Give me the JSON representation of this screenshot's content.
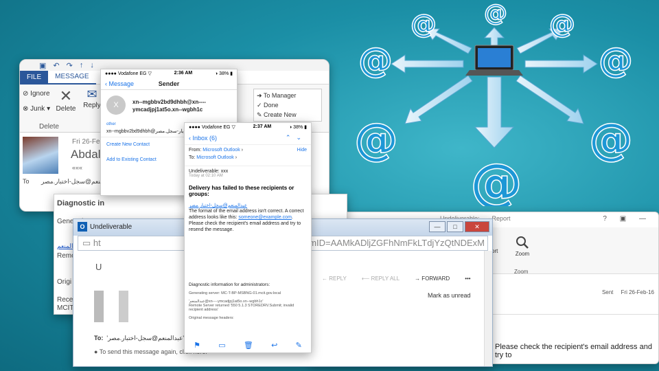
{
  "outlook": {
    "tab_file": "FILE",
    "tab_message": "MESSAGE",
    "ignore": "Ignore",
    "junk": "Junk",
    "delete_btn": "Delete",
    "reply": "Reply",
    "group_delete": "Delete",
    "to_manager": "To Manager",
    "done": "Done",
    "create_new": "Create New",
    "date": "Fri 26-Feb-",
    "name": "Abdalu",
    "extra": "«««",
    "to_label": "To",
    "to_value": "'عبدالمنعم@سجل-اختبار.مصر"
  },
  "phone_sender": {
    "carrier": "●●●● Vodafone EG ▽",
    "time": "2:36 AM",
    "battery": "◑ 38% ▮",
    "back": "Message",
    "title": "Sender",
    "avatar_letter": "X",
    "address_line1": "xn--mgbbv2bd9dhbh@xn----",
    "address_line2": "ymcadjpj1at5o.xn--wgbh1c",
    "other_label": "other",
    "other_value": "xn--mgbbv2bd9dhbh@يار-سجل.مصر",
    "create_contact": "Create New Contact",
    "add_existing": "Add to Existing Contact"
  },
  "phone_bounce": {
    "carrier": "●●●● Vodafone EG ▽",
    "time": "2:37 AM",
    "battery": "◑ 38% ▮",
    "back": "Inbox (6)",
    "from_label": "From:",
    "from_value": "Microsoft Outlook",
    "hide": "Hide",
    "to_label": "To:",
    "to_value": "Microsoft Outlook",
    "subject": "Undeliverable: xxx",
    "when": "Today at 02:10 AM",
    "headline": "Delivery has failed to these recipients or groups:",
    "recipient": "عبدالمنعم@سجل-اختبار.مصر",
    "body1": "The format of the email address isn't correct. A correct address looks like this:",
    "example": "someone@example.com",
    "body2": ". Please check the recipient's email address and try to resend the message.",
    "diag_title": "Diagnostic information for administrators:",
    "gen_server": "Generating server: MC-T-BP-MSBNG-01.mcit.gov.local",
    "diag_addr": "'عبدالمنعم@xn----ymcadjpj1at5o.xn--wgbh1c'",
    "remote": "Remote Server returned '550 5.1.3 STOREDRV.Submit; invalid recipient address'",
    "orig_headers": "Original message headers:"
  },
  "diagnostic": {
    "title": "Diagnostic in",
    "general": "Generati",
    "recip": "عبدالمنعم",
    "remote": "Remo",
    "orig": "Origi",
    "received": "Receiv",
    "mcit": "MCIT"
  },
  "reader": {
    "tab_title": "Undeliverable: ... - Report",
    "controls": "? ▣ —",
    "zoom": "Zoom",
    "zoom_group": "Zoom",
    "ort": "ort",
    "sent_label": "Sent",
    "sent_value": "Fri 26-Feb-16",
    "tail": "Please check the recipient's email address and try to"
  },
  "browser": {
    "title": "Undeliverable",
    "url_left": "ht",
    "url_right": "m&ItemID=AAMkADljZGFhNmFkLTdjYzQtNDExM",
    "subject": "U",
    "reply": "← REPLY",
    "reply_all": "⟵ REPLY ALL",
    "forward": "→ FORWARD",
    "more": "•••",
    "mark_unread": "Mark as unread",
    "to_label": "To:",
    "to_value": "'عبدالمنعم@سجل-اختبار.مصر' <??",
    "send_again": "● To send this message again, click here."
  },
  "network": {
    "at_symbol": "@",
    "color": "#1d97d6"
  }
}
